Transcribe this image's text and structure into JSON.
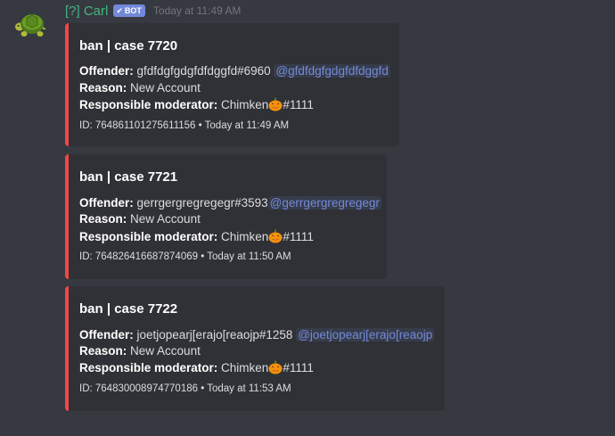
{
  "message": {
    "author": "[?] Carl",
    "bot_tag": "BOT",
    "timestamp": "Today at 11:49 AM"
  },
  "labels": {
    "offender": "Offender:",
    "reason": "Reason:",
    "moderator": "Responsible moderator:"
  },
  "embeds": [
    {
      "title": "ban | case 7720",
      "offender": "gfdfdgfgdgfdfdggfd#6960",
      "mention": "@gfdfdgfgdgfdfdggfd",
      "reason": "New Account",
      "moderator_name": "Chimken",
      "moderator_discrim": "#1111",
      "footer": "ID: 764861101275611156 • Today at 11:49 AM"
    },
    {
      "title": "ban | case 7721",
      "offender": "gerrgergregregegr#3593",
      "mention": "@gerrgergregregegr",
      "reason": "New Account",
      "moderator_name": "Chimken",
      "moderator_discrim": "#1111",
      "footer": "ID: 764826416687874069 • Today at 11:50 AM"
    },
    {
      "title": "ban | case 7722",
      "offender": "joetjopearj[erajo[reaojp#1258",
      "mention": "@joetjopearj[erajo[reaojp",
      "reason": "New Account",
      "moderator_name": "Chimken",
      "moderator_discrim": "#1111",
      "footer": "ID: 764830008974770186 • Today at 11:53 AM"
    }
  ],
  "colors": {
    "background": "#36393f",
    "embed_bg": "#2f3136",
    "embed_border": "#f04747",
    "username": "#43b581",
    "mention": "#7289da",
    "bot_tag": "#7289da"
  },
  "icons": {
    "avatar": "turtle-avatar",
    "emoji": "pumpkin-emoji",
    "verified": "check-icon"
  }
}
